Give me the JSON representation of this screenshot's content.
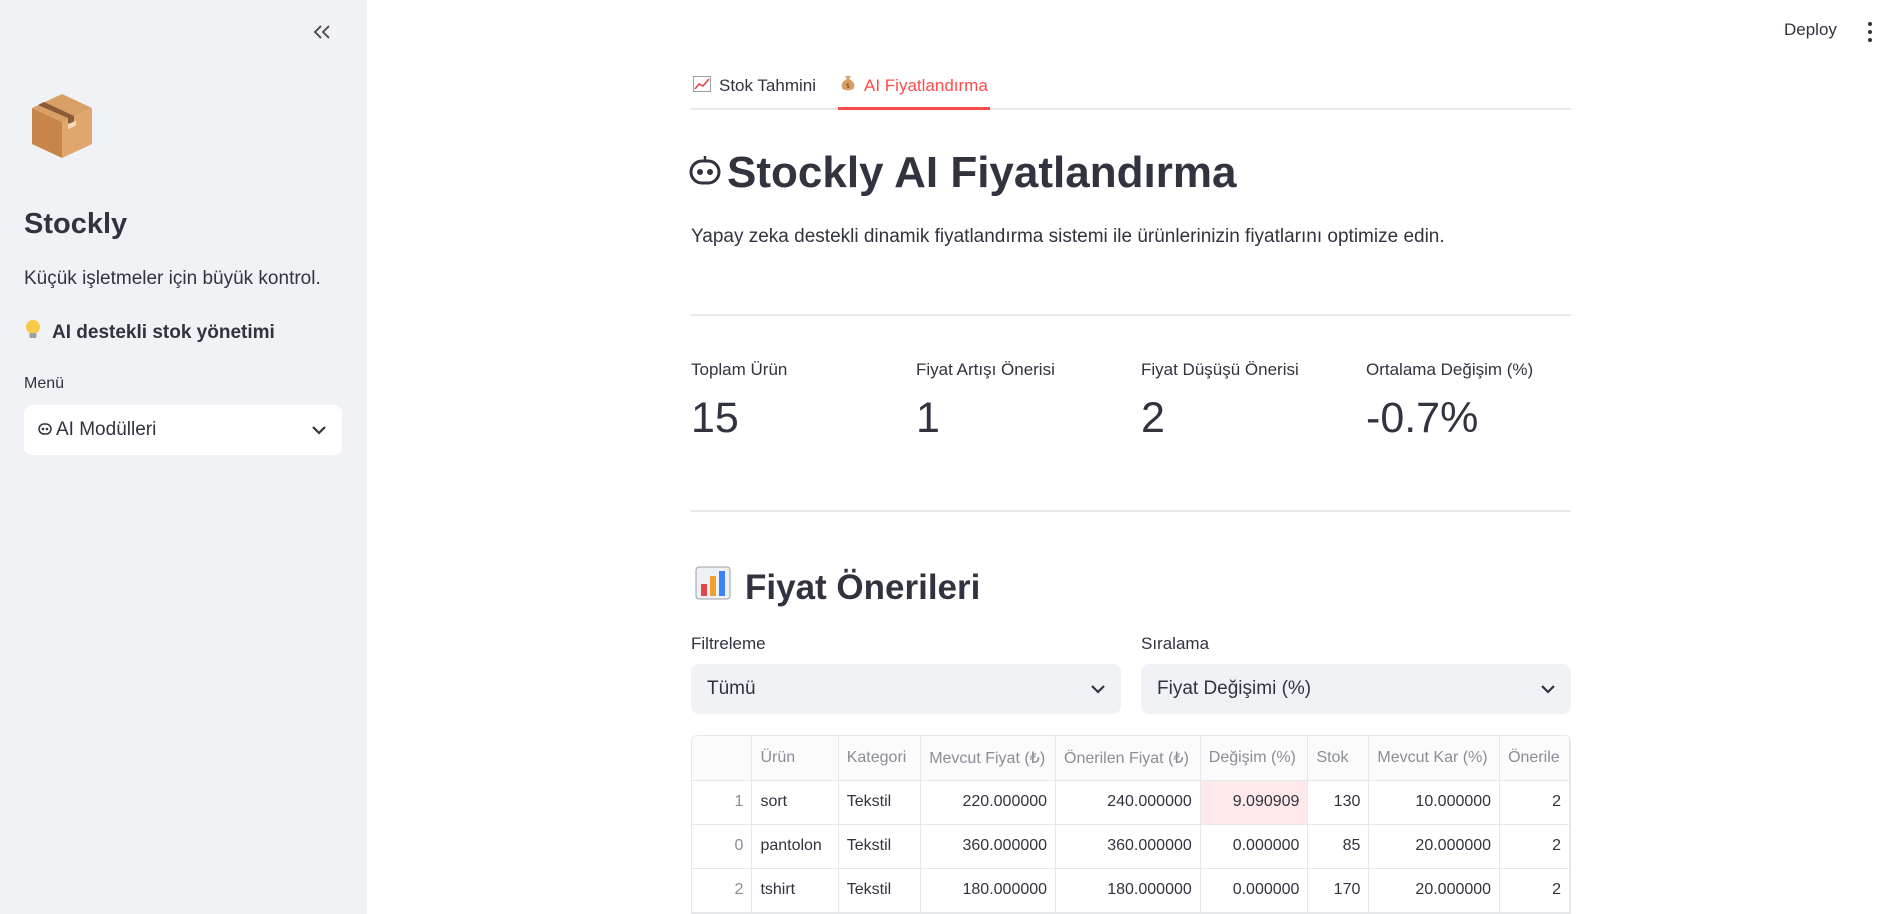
{
  "sidebar": {
    "brand": "Stockly",
    "tagline": "Küçük işletmeler için büyük kontrol.",
    "ai_line": "AI destekli stok yönetimi",
    "menu_label": "Menü",
    "menu_value": "AI Modülleri"
  },
  "header": {
    "deploy": "Deploy"
  },
  "tabs": [
    {
      "label": "Stok Tahmini",
      "icon": "chart-increasing-icon"
    },
    {
      "label": "AI Fiyatlandırma",
      "icon": "money-bag-icon",
      "active": true
    }
  ],
  "page": {
    "title": "Stockly AI Fiyatlandırma",
    "subtitle": "Yapay zeka destekli dinamik fiyatlandırma sistemi ile ürünlerinizin fiyatlarını optimize edin."
  },
  "metrics": [
    {
      "label": "Toplam Ürün",
      "value": "15"
    },
    {
      "label": "Fiyat Artışı Önerisi",
      "value": "1"
    },
    {
      "label": "Fiyat Düşüşü Önerisi",
      "value": "2"
    },
    {
      "label": "Ortalama Değişim (%)",
      "value": "-0.7%"
    }
  ],
  "section": {
    "title": "Fiyat Önerileri",
    "filter_label": "Filtreleme",
    "filter_value": "Tümü",
    "sort_label": "Sıralama",
    "sort_value": "Fiyat Değişimi (%)"
  },
  "table": {
    "headers": [
      "",
      "Ürün",
      "Kategori",
      "Mevcut Fiyat (₺)",
      "Önerilen Fiyat (₺)",
      "Değişim (%)",
      "Stok",
      "Mevcut Kar (%)",
      "Önerile"
    ],
    "rows": [
      [
        "1",
        "sort",
        "Tekstil",
        "220.000000",
        "240.000000",
        "9.090909",
        "130",
        "10.000000",
        "2"
      ],
      [
        "0",
        "pantolon",
        "Tekstil",
        "360.000000",
        "360.000000",
        "0.000000",
        "85",
        "20.000000",
        "2"
      ],
      [
        "2",
        "tshirt",
        "Tekstil",
        "180.000000",
        "180.000000",
        "0.000000",
        "170",
        "20.000000",
        "2"
      ]
    ]
  },
  "colors": {
    "accent": "#ff4b4b",
    "sidebar_bg": "#f0f2f6",
    "text": "#31333f",
    "highlight": "#ffe9ea"
  }
}
